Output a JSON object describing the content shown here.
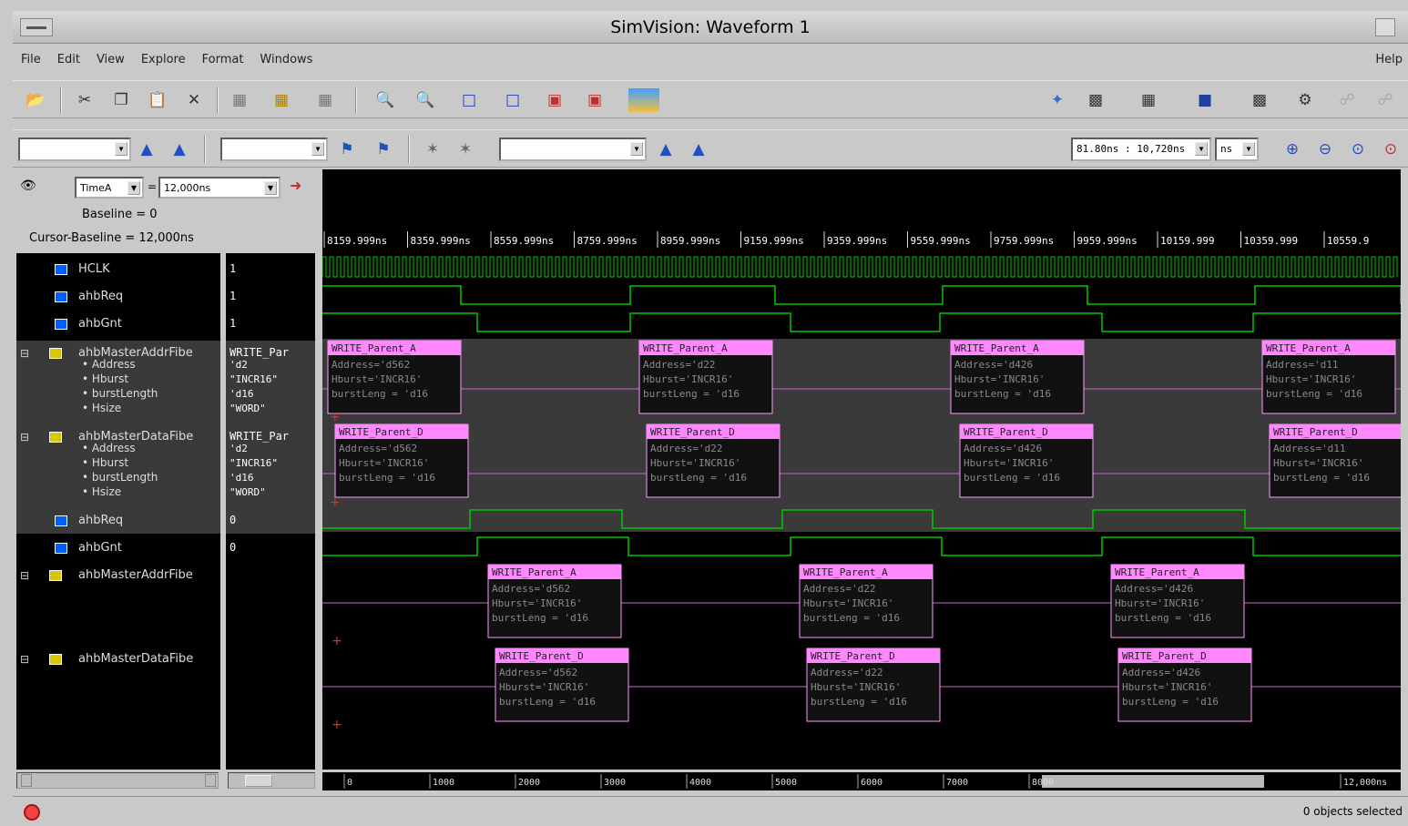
{
  "window": {
    "title": "SimVision: Waveform 1"
  },
  "menu": [
    "File",
    "Edit",
    "View",
    "Explore",
    "Format",
    "Windows"
  ],
  "menu_help": "Help",
  "toolbar": {
    "time_range_value": "81.80ns : 10,720ns",
    "time_unit": "ns"
  },
  "cursor_panel": {
    "cursor_select": "TimeA",
    "cursor_time": "12,000ns",
    "baseline": "Baseline = 0",
    "cursor_baseline": "Cursor-Baseline = 12,000ns"
  },
  "time_ticks": [
    "8159.999ns",
    "8359.999ns",
    "8559.999ns",
    "8759.999ns",
    "8959.999ns",
    "9159.999ns",
    "9359.999ns",
    "9559.999ns",
    "9759.999ns",
    "9959.999ns",
    "10159.999",
    "10359.999",
    "10559.9"
  ],
  "signals": [
    {
      "name": "HCLK",
      "value": "1",
      "color": "#0060ff"
    },
    {
      "name": "ahbReq",
      "value": "1",
      "color": "#0060ff"
    },
    {
      "name": "ahbGnt",
      "value": "1",
      "color": "#0060ff"
    },
    {
      "name": "ahbMasterAddrFibe",
      "value": "WRITE_Par",
      "color": "#d8c800",
      "fields": [
        "Address",
        "Hburst",
        "burstLength",
        "Hsize"
      ],
      "field_values": [
        "'d2",
        "\"INCR16\"",
        "'d16",
        "\"WORD\""
      ]
    },
    {
      "name": "ahbMasterDataFibe",
      "value": "WRITE_Par",
      "color": "#d8c800",
      "fields": [
        "Address",
        "Hburst",
        "burstLength",
        "Hsize"
      ],
      "field_values": [
        "'d2",
        "\"INCR16\"",
        "'d16",
        "\"WORD\""
      ]
    },
    {
      "name": "ahbReq",
      "value": "0",
      "color": "#0060ff"
    },
    {
      "name": "ahbGnt",
      "value": "0",
      "color": "#0060ff"
    },
    {
      "name": "ahbMasterAddrFibe",
      "value": "",
      "color": "#d8c800"
    },
    {
      "name": "ahbMasterDataFibe",
      "value": "",
      "color": "#d8c800"
    }
  ],
  "transactions_addr_top": [
    {
      "title": "WRITE_Parent_A",
      "lines": [
        "Address='d562",
        "Hburst='INCR16'",
        "burstLeng = 'd16"
      ]
    },
    {
      "title": "WRITE_Parent_A",
      "lines": [
        "Address='d22",
        "Hburst='INCR16'",
        "burstLeng = 'd16"
      ]
    },
    {
      "title": "WRITE_Parent_A",
      "lines": [
        "Address='d426",
        "Hburst='INCR16'",
        "burstLeng = 'd16"
      ]
    },
    {
      "title": "WRITE_Parent_A",
      "lines": [
        "Address='d11",
        "Hburst='INCR16'",
        "burstLeng = 'd16"
      ]
    }
  ],
  "transactions_data_top": [
    {
      "title": "WRITE_Parent_D",
      "lines": [
        "Address='d562",
        "Hburst='INCR16'",
        "burstLeng = 'd16"
      ]
    },
    {
      "title": "WRITE_Parent_D",
      "lines": [
        "Address='d22",
        "Hburst='INCR16'",
        "burstLeng = 'd16"
      ]
    },
    {
      "title": "WRITE_Parent_D",
      "lines": [
        "Address='d426",
        "Hburst='INCR16'",
        "burstLeng = 'd16"
      ]
    },
    {
      "title": "WRITE_Parent_D",
      "lines": [
        "Address='d11",
        "Hburst='INCR16'",
        "burstLeng = 'd16"
      ]
    }
  ],
  "transactions_addr_bottom": [
    {
      "title": "WRITE_Parent_A",
      "lines": [
        "Address='d562",
        "Hburst='INCR16'",
        "burstLeng = 'd16"
      ]
    },
    {
      "title": "WRITE_Parent_A",
      "lines": [
        "Address='d22",
        "Hburst='INCR16'",
        "burstLeng = 'd16"
      ]
    },
    {
      "title": "WRITE_Parent_A",
      "lines": [
        "Address='d426",
        "Hburst='INCR16'",
        "burstLeng = 'd16"
      ]
    }
  ],
  "transactions_data_bottom": [
    {
      "title": "WRITE_Parent_D",
      "lines": [
        "Address='d562",
        "Hburst='INCR16'",
        "burstLeng = 'd16"
      ]
    },
    {
      "title": "WRITE_Parent_D",
      "lines": [
        "Address='d22",
        "Hburst='INCR16'",
        "burstLeng = 'd16"
      ]
    },
    {
      "title": "WRITE_Parent_D",
      "lines": [
        "Address='d426",
        "Hburst='INCR16'",
        "burstLeng = 'd16"
      ]
    }
  ],
  "overview_ticks": [
    "0",
    "1000",
    "2000",
    "3000",
    "4000",
    "5000",
    "6000",
    "7000",
    "8000",
    "12,000ns"
  ],
  "status": {
    "text": "0 objects selected"
  },
  "colors": {
    "wave": "#00c800",
    "txn_fill": "#ff88ff",
    "txn_border": "#ff99ff",
    "txn_text": "#8a8a8a",
    "bus_line": "#cc66cc",
    "marker": "#ff2020"
  }
}
